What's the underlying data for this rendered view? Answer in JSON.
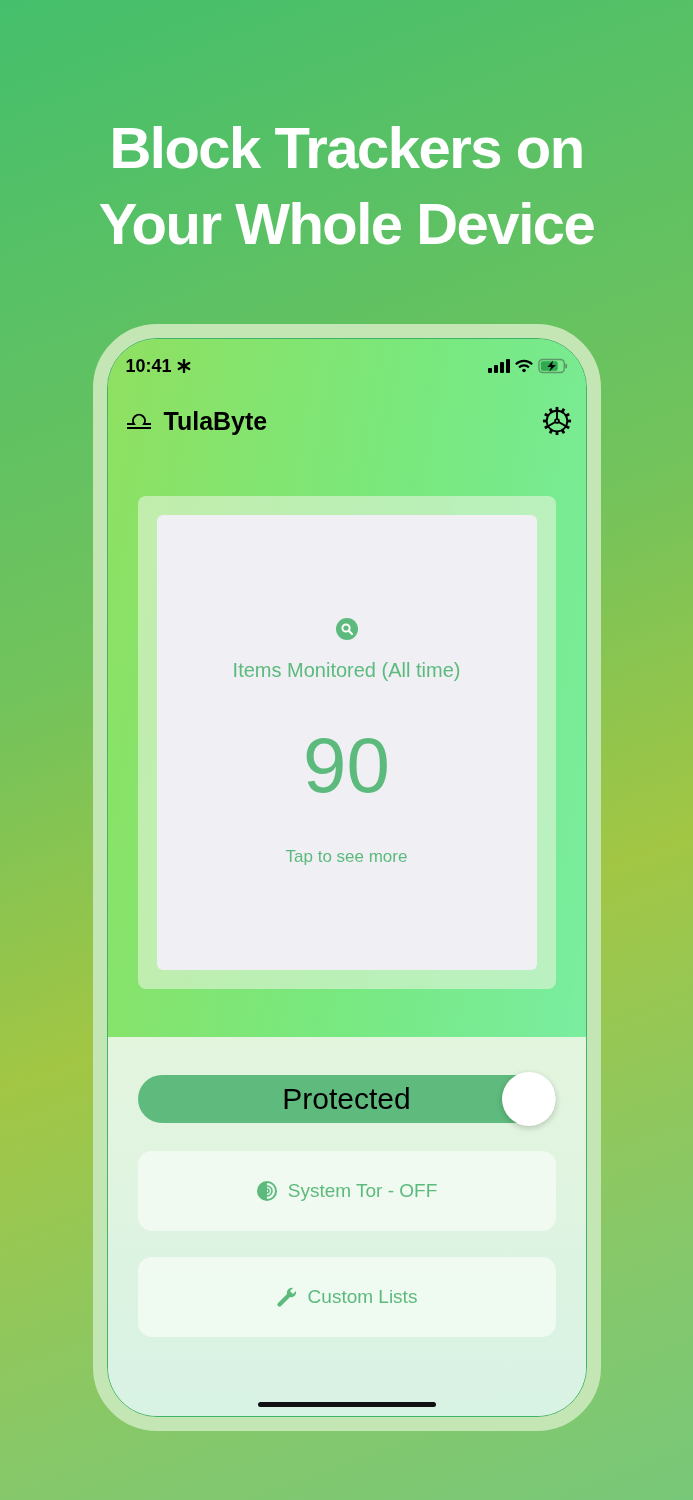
{
  "headline": [
    "Block Trackers on",
    "Your Whole Device"
  ],
  "status_bar": {
    "time": "10:41"
  },
  "app": {
    "title": "TulaByte"
  },
  "stats_card": {
    "label": "Items Monitored (All time)",
    "value": "90",
    "hint": "Tap to see more"
  },
  "protection_toggle": {
    "label": "Protected",
    "on": true
  },
  "buttons": [
    {
      "kind": "tor",
      "label": "System Tor - OFF"
    },
    {
      "kind": "lists",
      "label": "Custom Lists"
    }
  ]
}
